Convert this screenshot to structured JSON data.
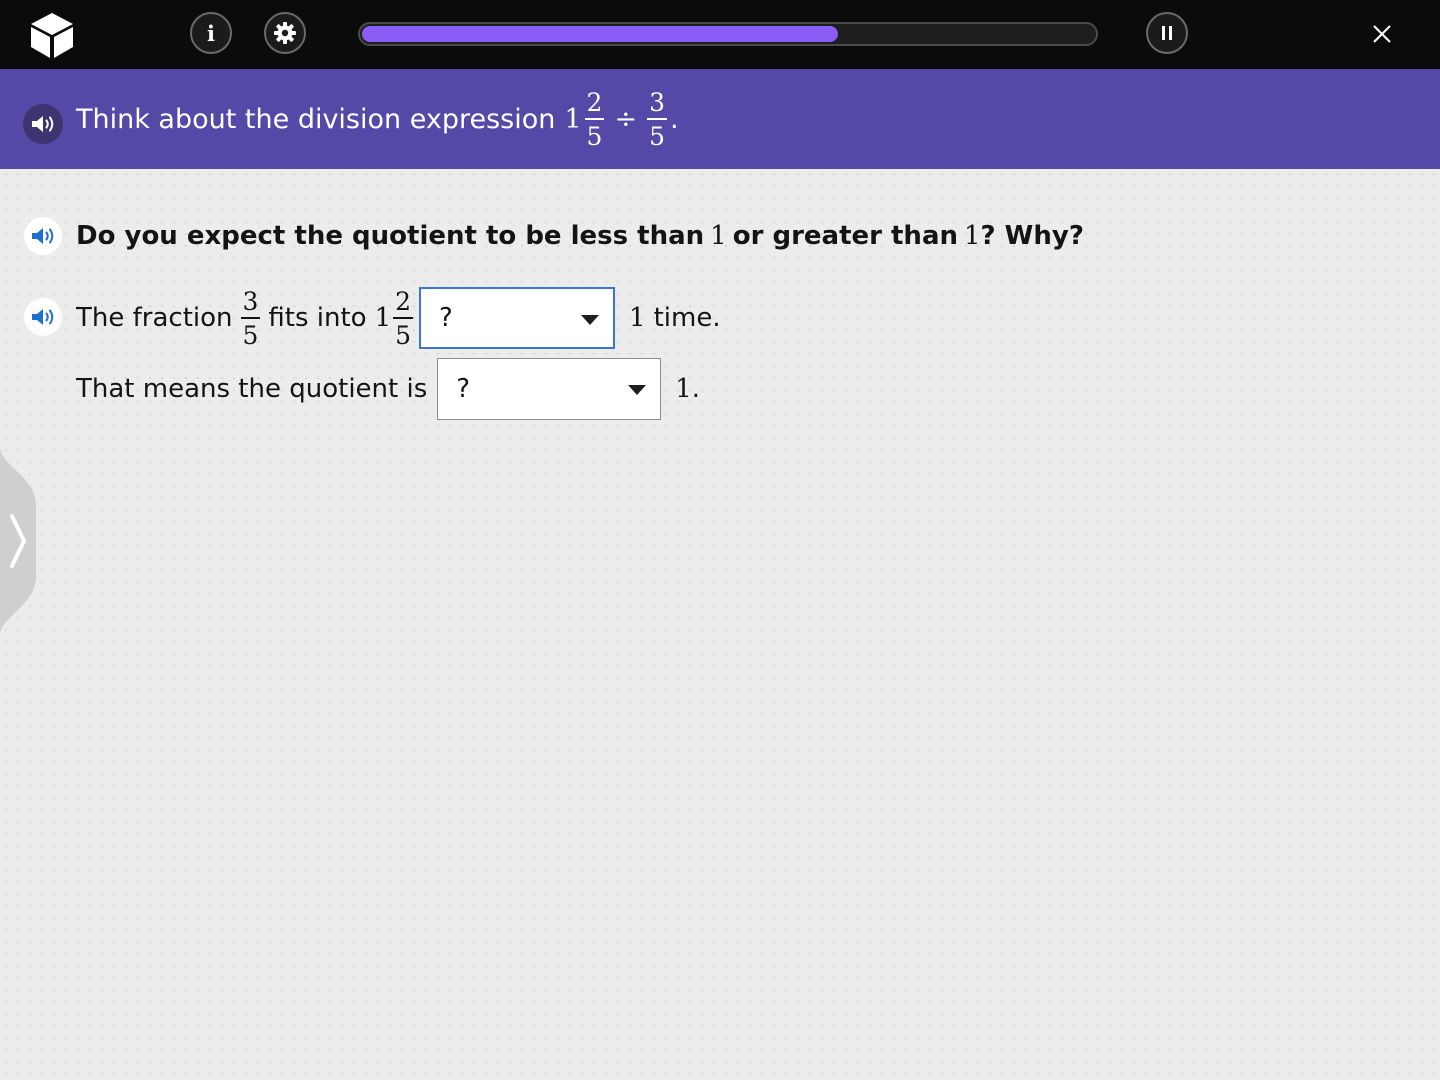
{
  "topbar": {
    "info_label": "i",
    "progress_percent": 65,
    "colors": {
      "background": "#0b0b0b",
      "progress": "#8b5cf6"
    },
    "icons": [
      "cube-logo-icon",
      "info-icon",
      "gear-icon",
      "pause-icon",
      "close-icon"
    ]
  },
  "prompt": {
    "text": "Think about the division expression",
    "whole": "1",
    "fraction_a": {
      "num": "2",
      "den": "5"
    },
    "operator": "÷",
    "fraction_b": {
      "num": "3",
      "den": "5"
    },
    "end": ".",
    "color": "#5449a6"
  },
  "question": {
    "part1": "Do you expect the quotient to be less than",
    "num1": "1",
    "part2": "or greater than",
    "num2": "1",
    "part3": "? Why?"
  },
  "line1": {
    "text_before": "The fraction",
    "fraction": {
      "num": "3",
      "den": "5"
    },
    "text_middle": "fits into",
    "whole": "1",
    "mixed_fraction": {
      "num": "2",
      "den": "5"
    },
    "dropdown_value": "?",
    "after_num": "1",
    "after_text": "time."
  },
  "line2": {
    "text_before": "That means the quotient is",
    "dropdown_value": "?",
    "after_num": "1",
    "after_text": "."
  },
  "sidebar": {
    "toggle_icon": "chevron-right-icon"
  }
}
